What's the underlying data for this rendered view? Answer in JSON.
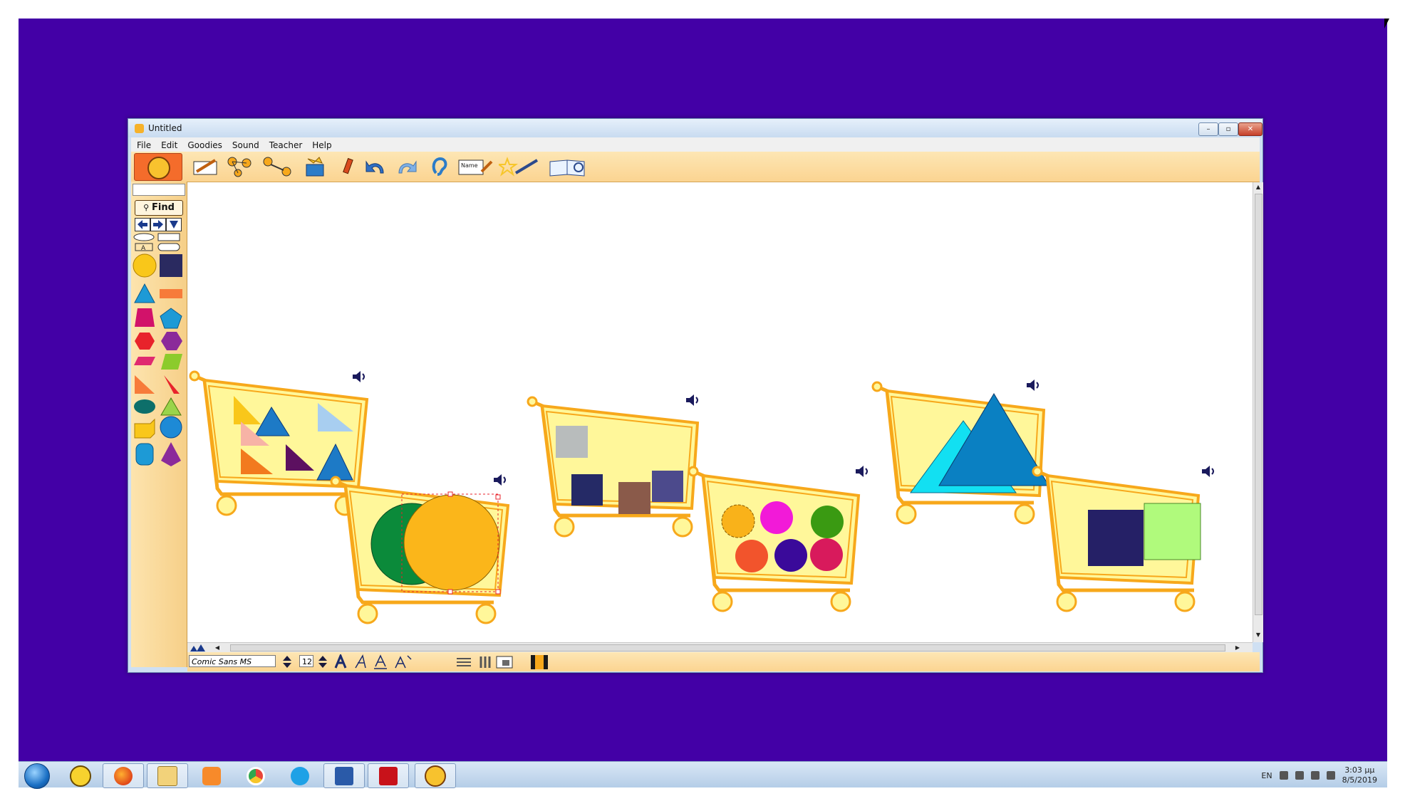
{
  "window": {
    "title": "Untitled",
    "minimize_glyph": "–",
    "maximize_glyph": "▫",
    "close_glyph": "✕"
  },
  "menu": [
    "File",
    "Edit",
    "Goodies",
    "Sound",
    "Teacher",
    "Help"
  ],
  "toolbar": {
    "name_tool_label": "Name",
    "icons": [
      "draw-icon",
      "connect-icon",
      "link-icon",
      "box-icon",
      "pencil-icon",
      "undo-icon",
      "redo-icon",
      "listen-icon",
      "name-icon",
      "magic-wand-icon",
      "book-icon"
    ]
  },
  "left_panel": {
    "find_label": "Find",
    "text_tool_label": "A"
  },
  "format_bar": {
    "font_name": "Comic Sans MS",
    "font_size": "12"
  },
  "taskbar": {
    "language": "EN",
    "time": "3:03 μμ",
    "date": "8/5/2019",
    "apps": [
      "start-orb-icon",
      "transfer-icon",
      "firefox-icon",
      "file-explorer-icon",
      "media-player-icon",
      "chrome-icon",
      "skype-icon",
      "word-icon",
      "acrobat-icon",
      "kidspiration-icon"
    ]
  },
  "colors": {
    "desktop": "#4300a6",
    "cart_fill": "#fff79a",
    "cart_stroke": "#f7a81b",
    "panel": "#fbd491"
  }
}
